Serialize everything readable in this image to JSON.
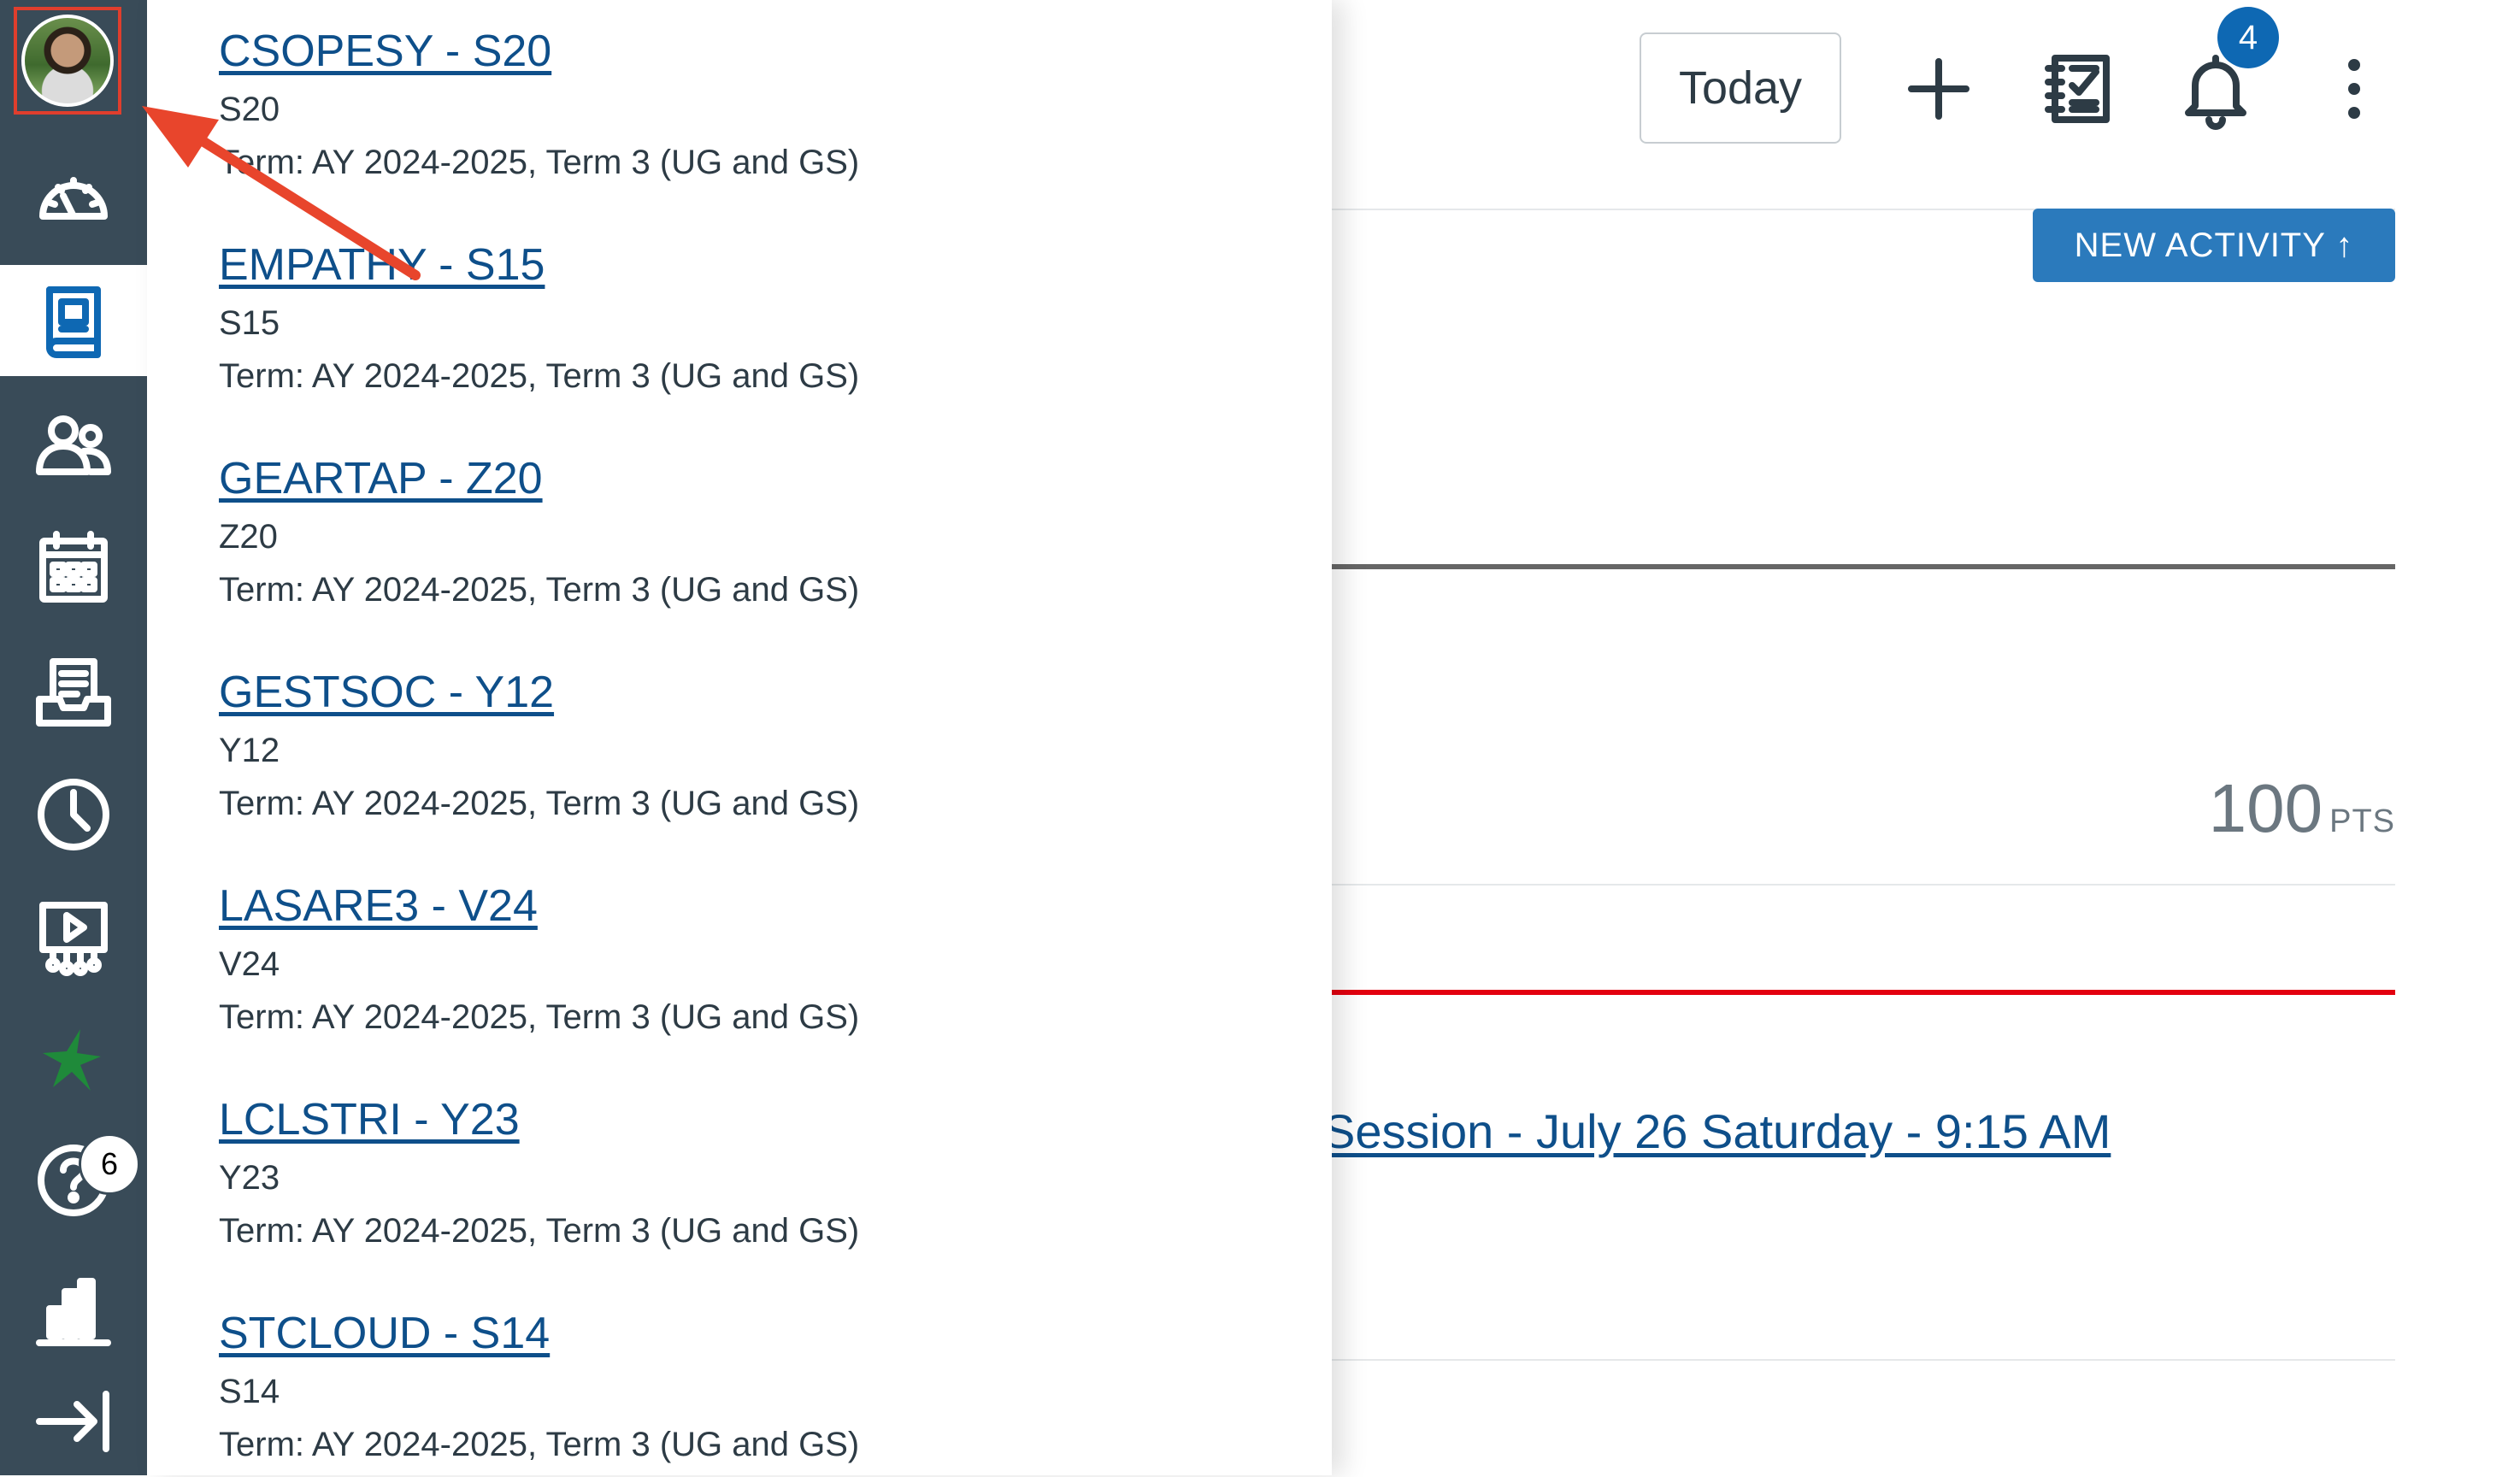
{
  "nav": {
    "items": [
      "account",
      "dashboard",
      "courses",
      "groups",
      "calendar",
      "inbox",
      "history",
      "studio",
      "commons",
      "help",
      "library",
      "collapse"
    ],
    "help_badge": "6",
    "accent_color": "#394b58"
  },
  "courses": [
    {
      "title": "CSOPESY - S20",
      "section": "S20",
      "term": "Term: AY 2024-2025, Term 3 (UG and GS)"
    },
    {
      "title": "EMPATHY - S15",
      "section": "S15",
      "term": "Term: AY 2024-2025, Term 3 (UG and GS)"
    },
    {
      "title": "GEARTAP - Z20",
      "section": "Z20",
      "term": "Term: AY 2024-2025, Term 3 (UG and GS)"
    },
    {
      "title": "GESTSOC - Y12",
      "section": "Y12",
      "term": "Term: AY 2024-2025, Term 3 (UG and GS)"
    },
    {
      "title": "LASARE3 - V24",
      "section": "V24",
      "term": "Term: AY 2024-2025, Term 3 (UG and GS)"
    },
    {
      "title": "LCLSTRI - Y23",
      "section": "Y23",
      "term": "Term: AY 2024-2025, Term 3 (UG and GS)"
    },
    {
      "title": "STCLOUD - S14",
      "section": "S14",
      "term": "Term: AY 2024-2025, Term 3 (UG and GS)"
    }
  ],
  "header": {
    "today_label": "Today",
    "notification_count": "4"
  },
  "planner": {
    "new_activity_label": "NEW ACTIVITY ↑",
    "points_value": "100",
    "points_unit": "PTS",
    "session_link": "Session - July 26 Saturday - 9:15 AM"
  },
  "colors": {
    "link": "#0e4f8a",
    "primary": "#2b7abc",
    "badge": "#0e68b3",
    "today_line": "#e3000f",
    "annotation": "#e8452c"
  }
}
